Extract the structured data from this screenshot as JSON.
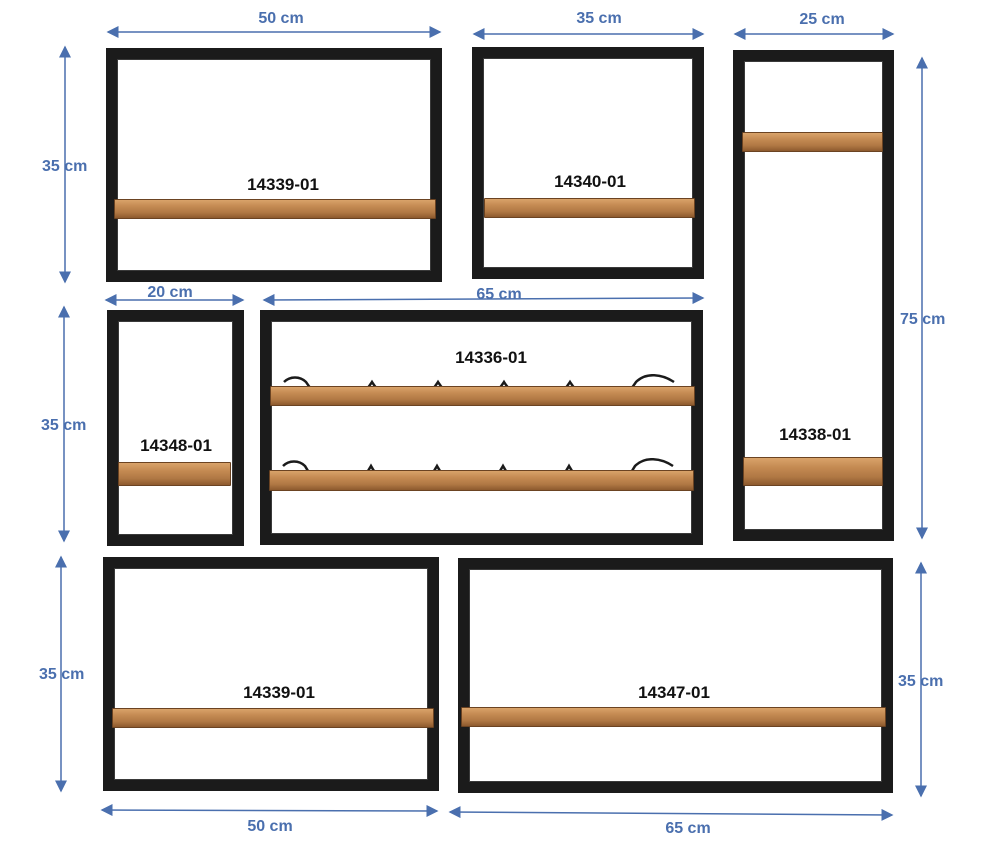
{
  "colors": {
    "dimension": "#4a6fae",
    "frame": "#1b1b1b",
    "wood": "#c48a52",
    "label": "#111111"
  },
  "shelves": [
    {
      "code": "14339-01",
      "width": "50 cm",
      "height": "35 cm"
    },
    {
      "code": "14340-01",
      "width": "35 cm"
    },
    {
      "code": "14338-01",
      "width": "25 cm",
      "height": "75 cm"
    },
    {
      "code": "14348-01",
      "width": "20 cm",
      "height": "35 cm"
    },
    {
      "code": "14336-01",
      "width": "65 cm"
    },
    {
      "code": "14339-01",
      "width": "50 cm",
      "height": "35 cm"
    },
    {
      "code": "14347-01",
      "width": "65 cm",
      "height": "35 cm"
    }
  ]
}
